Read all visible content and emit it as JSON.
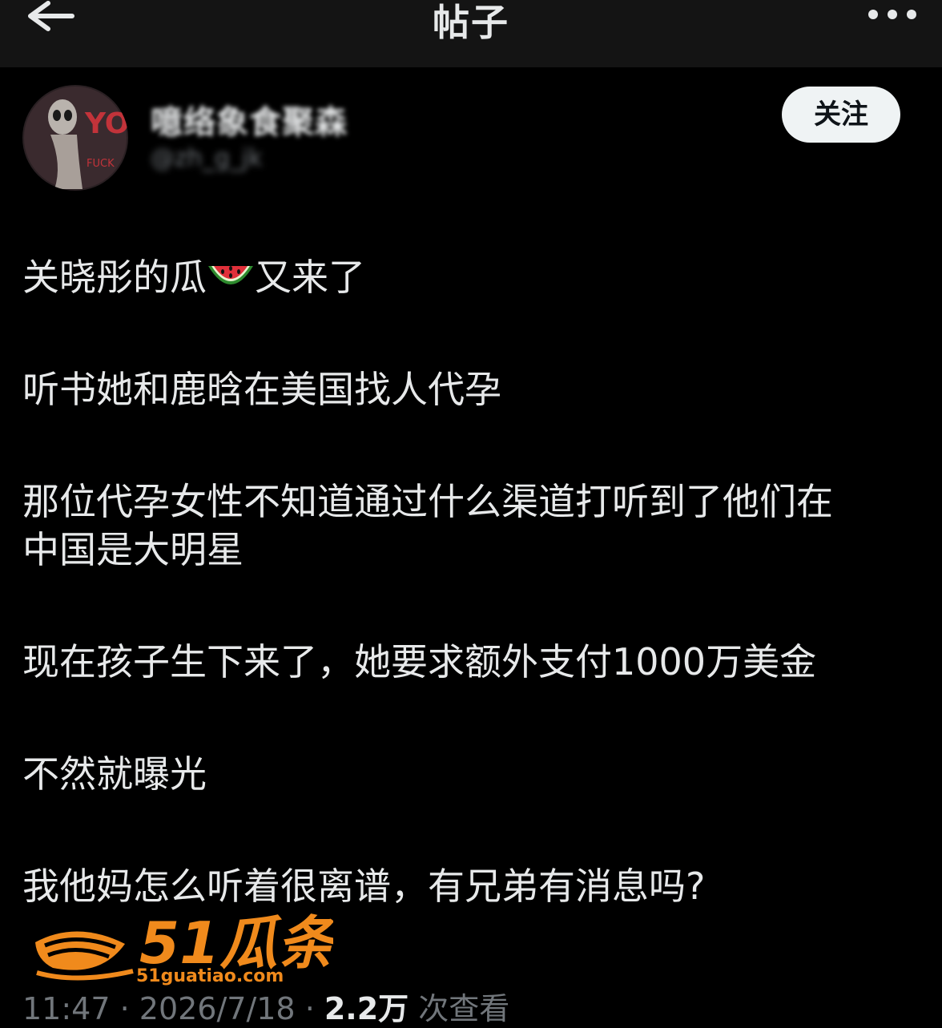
{
  "header": {
    "title": "帖子"
  },
  "author": {
    "display_name": "噫络象食聚森",
    "handle": "@zh_g_jk",
    "follow_label": "关注",
    "avatar_text": "YOU"
  },
  "post": {
    "paragraphs": [
      {
        "before": "关晓彤的瓜",
        "emoji": "watermelon-icon",
        "after": "又来了"
      },
      {
        "text": "听书她和鹿晗在美国找人代孕"
      },
      {
        "line1": "那位代孕女性不知道通过什么渠道打听到了他们在",
        "line2": "中国是大明星"
      },
      {
        "text": "现在孩子生下来了，她要求额外支付1000万美金"
      },
      {
        "text": "不然就曝光"
      },
      {
        "text": "我他妈怎么听着很离谱，有兄弟有消息吗?"
      }
    ]
  },
  "watermark": {
    "brand": "51瓜条",
    "url": "51guatiao.com"
  },
  "meta": {
    "time": "11:47",
    "sep1": " · ",
    "date": "2026/7/18",
    "sep2": " · ",
    "views": "2.2万",
    "views_label": " 次查看"
  },
  "colors": {
    "background": "#000000",
    "text": "#e7e9ea",
    "muted": "#71767b",
    "follow_bg": "#eff3f4",
    "watermark": "#f08a1c"
  }
}
